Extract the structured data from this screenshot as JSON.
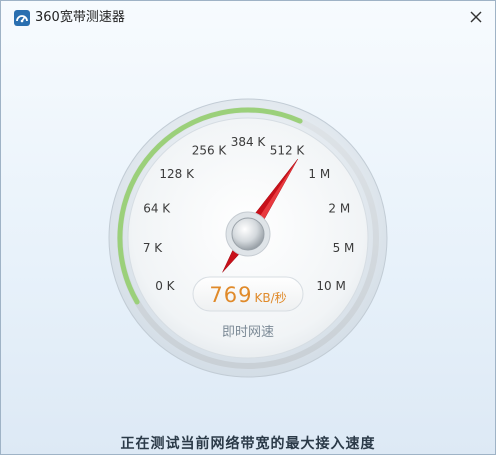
{
  "window": {
    "title": "360宽带测速器"
  },
  "icons": {
    "app": "app-logo-icon",
    "close": "close-icon"
  },
  "gauge": {
    "scale_labels": [
      "0 K",
      "7 K",
      "64 K",
      "128 K",
      "256 K",
      "384 K",
      "512 K",
      "1 M",
      "2 M",
      "5 M",
      "10 M"
    ],
    "reading": "769",
    "unit": "KB/秒",
    "caption": "即时网速",
    "needle_position": 6.4,
    "progress_fraction": 0.6,
    "accent_color": "#e08a2a",
    "progress_color": "#9bd07a",
    "needle_color": "#c8101a"
  },
  "status": {
    "message": "正在测试当前网络带宽的最大接入速度"
  }
}
